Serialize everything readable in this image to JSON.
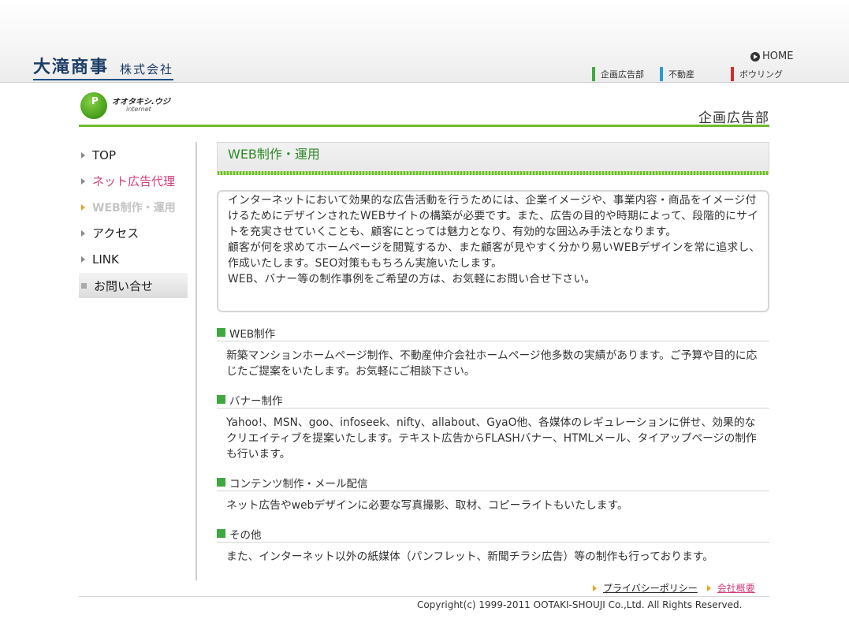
{
  "header": {
    "company_name": "大滝商事",
    "company_suffix": "株式会社",
    "home_label": "HOME",
    "nav": [
      {
        "label": "企画広告部",
        "color": "#3fa83f"
      },
      {
        "label": "不動産",
        "color": "#2a9bd6"
      },
      {
        "label": "ボウリング",
        "color": "#d62b2b"
      }
    ]
  },
  "brand": {
    "logo_text": "オオタキシ.ウジ",
    "logo_sub": "internet",
    "department": "企画広告部"
  },
  "sidebar": {
    "items": [
      {
        "label": "TOP"
      },
      {
        "label": "ネット広告代理"
      },
      {
        "label": "WEB制作・運用"
      },
      {
        "label": "アクセス"
      },
      {
        "label": "LINK"
      },
      {
        "label": "お問い合せ"
      }
    ]
  },
  "main": {
    "title": "WEB制作・運用",
    "intro": [
      "インターネットにおいて効果的な広告活動を行うためには、企業イメージや、事業内容・商品をイメージ付けるためにデザインされたWEBサイトの構築が必要です。また、広告の目的や時期によって、段階的にサイトを充実させていくことも、顧客にとっては魅力となり、有効的な囲込み手法となります。",
      "顧客が何を求めてホームページを閲覧するか、また顧客が見やすく分かり易いWEBデザインを常に追求し、作成いたします。SEO対策ももちろん実施いたします。",
      "WEB、バナー等の制作事例をご希望の方は、お気軽にお問い合せ下さい。"
    ],
    "sections": [
      {
        "heading": "WEB制作",
        "body": "新築マンションホームページ制作、不動産仲介会社ホームページ他多数の実績があります。ご予算や目的に応じたご提案をいたします。お気軽にご相談下さい。"
      },
      {
        "heading": "バナー制作",
        "body": "Yahoo!、MSN、goo、infoseek、nifty、allabout、GyaO他、各媒体のレギュレーションに併せ、効果的なクリエイティブを提案いたします。テキスト広告からFLASHバナー、HTMLメール、タイアップページの制作も行います。"
      },
      {
        "heading": "コンテンツ制作・メール配信",
        "body": "ネット広告やwebデザインに必要な写真撮影、取材、コピーライトもいたします。"
      },
      {
        "heading": "その他",
        "body": "また、インターネット以外の紙媒体（パンフレット、新聞チラシ広告）等の制作も行っております。"
      }
    ]
  },
  "footer": {
    "links": [
      {
        "label": "プライバシーポリシー"
      },
      {
        "label": "会社概要"
      }
    ],
    "copyright": "Copyright(c) 1999-2011 OOTAKI-SHOUJI Co.,Ltd. All Rights Reserved."
  }
}
